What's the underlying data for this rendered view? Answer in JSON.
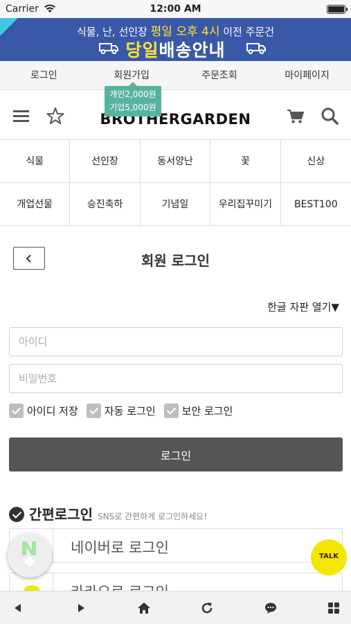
{
  "status_bar": {
    "carrier": "Carrier",
    "time": "12:00 AM"
  },
  "banner": {
    "line1_pre": "식물, 난, 선인장 ",
    "line1_highlight": "평일 오후 4시",
    "line1_post": " 이전 주문건",
    "line2_highlight": "당일",
    "line2_post": "배송안내"
  },
  "top_nav": [
    "로그인",
    "회원가입",
    "주문조회",
    "마이페이지"
  ],
  "signup_tooltip": {
    "line1": "개인2,000원",
    "line2": "기업5,000원"
  },
  "header": {
    "logo": "BROTHERGARDEN"
  },
  "categories": [
    "식물",
    "선인장",
    "동서양난",
    "꽃",
    "신상",
    "개업선물",
    "승진축하",
    "기념일",
    "우리집꾸미기",
    "BEST100"
  ],
  "login": {
    "title": "회원 로그인",
    "keyboard_toggle": "한글 자판 열기▼",
    "id_placeholder": "아이디",
    "pw_placeholder": "비밀번호",
    "checkboxes": [
      "아이디 저장",
      "자동 로그인",
      "보안 로그인"
    ],
    "button": "로그인"
  },
  "sns": {
    "title": "간편로그인",
    "subtitle": "SNS로 간편하게 로그인하세요!",
    "naver": "네이버로 로그인",
    "kakao": "카카오로 로그인"
  },
  "talk_badge": "TALK",
  "colors": {
    "banner": "#3a58a8",
    "highlight": "#ffe23b",
    "tooltip": "#58b39e",
    "login_button": "#555555",
    "naver": "#2db400",
    "kakao": "#f5e600"
  }
}
